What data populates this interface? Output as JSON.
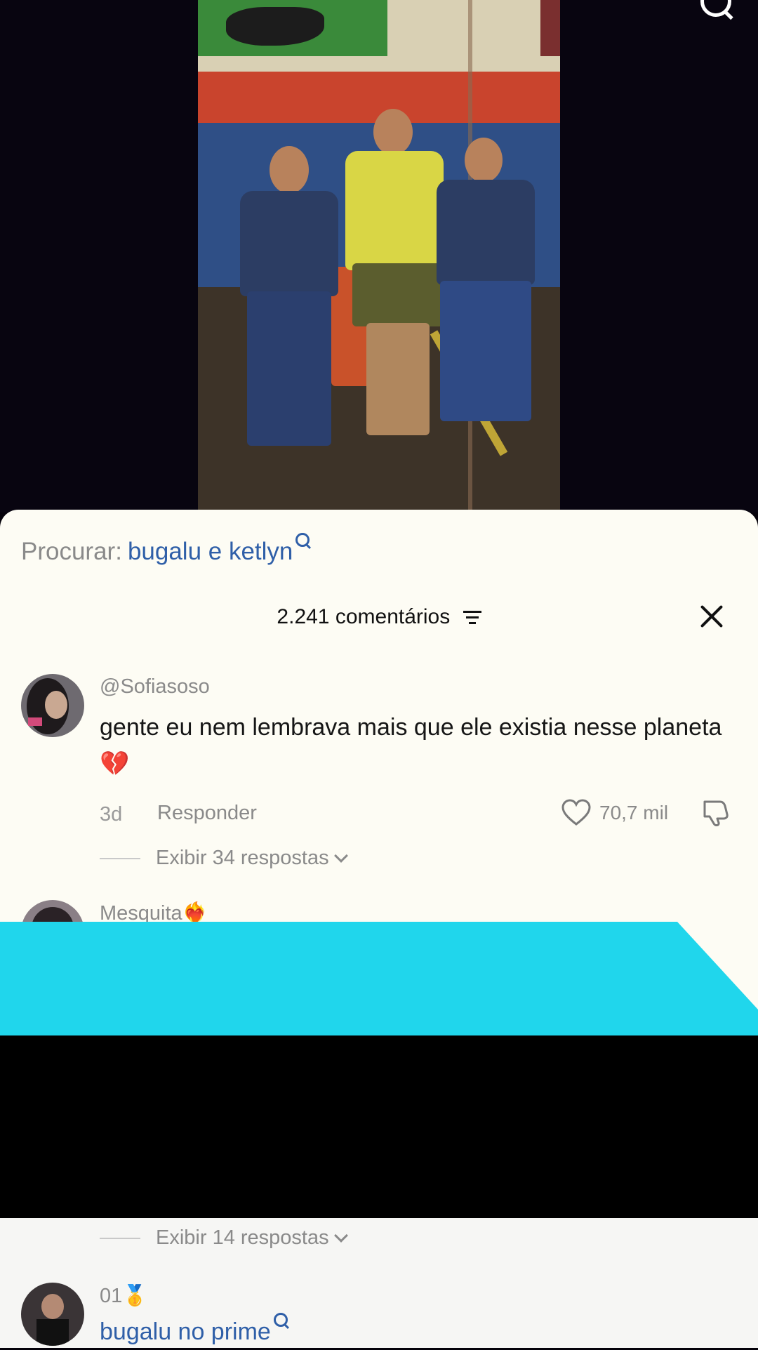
{
  "search": {
    "label": "Procurar:",
    "term": "bugalu e ketlyn"
  },
  "comments_header": {
    "count_label": "2.241 comentários"
  },
  "comments": [
    {
      "username": "@Sofiasoso",
      "text": "gente eu nem lembrava mais que ele existia nesse planeta💔",
      "age": "3d",
      "reply_label": "Responder",
      "likes": "70,7 mil",
      "view_replies": "Exibir 34 respostas"
    },
    {
      "username": "Mesquita❤️‍🔥"
    }
  ],
  "lower": {
    "view_replies": "Exibir 14 respostas",
    "username": "01🥇",
    "search_link": "bugalu no prime"
  },
  "colors": {
    "link": "#2f5fa8",
    "overlay_cyan": "#20d6ec"
  }
}
